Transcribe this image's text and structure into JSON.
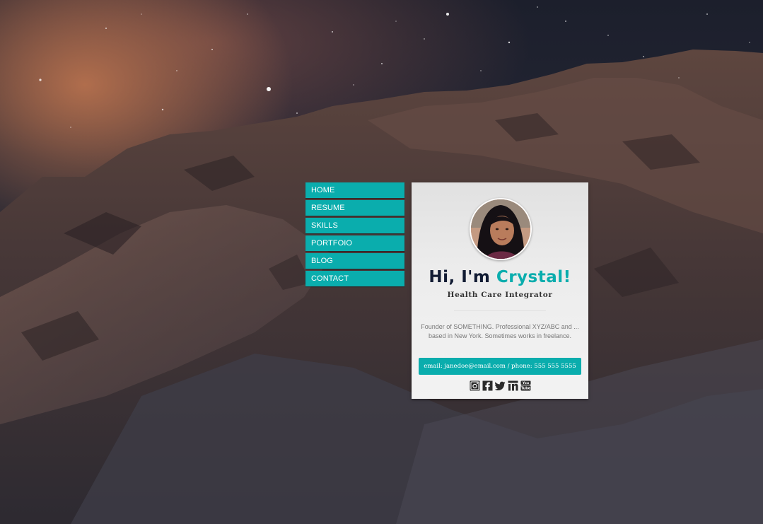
{
  "nav": {
    "items": [
      {
        "label": "HOME"
      },
      {
        "label": "RESUME"
      },
      {
        "label": "SKILLS"
      },
      {
        "label": "PORTFOIO"
      },
      {
        "label": "BLOG"
      },
      {
        "label": "CONTACT"
      }
    ]
  },
  "profile": {
    "greeting": "Hi, I'm ",
    "name": "Crystal!",
    "title": "Health Care Integrator",
    "bio": "Founder of SOMETHING. Professional XYZ/ABC and ... based in New York. Sometimes works in freelance.",
    "contact_text": "email: janedoe@email.com / phone: 555 555 5555"
  },
  "social": {
    "icons": [
      "instagram-icon",
      "facebook-icon",
      "twitter-icon",
      "linkedin-icon",
      "youtube-icon"
    ]
  },
  "colors": {
    "accent": "#0aadad",
    "heading": "#111b33",
    "card_bg": "#ececec"
  }
}
